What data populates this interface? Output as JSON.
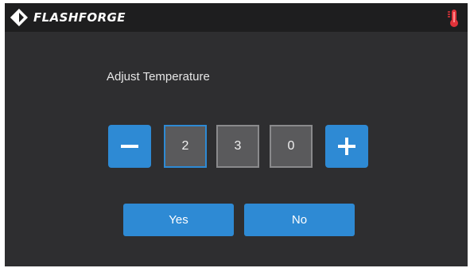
{
  "header": {
    "brand": "FLASHFORGE",
    "logo_icon": "flashforge-diamond-logo",
    "status_icon": "thermometer-icon"
  },
  "dialog": {
    "title": "Adjust Temperature",
    "decrement_icon": "minus-icon",
    "increment_icon": "plus-icon",
    "digits": [
      "2",
      "3",
      "0"
    ],
    "selected_digit_index": 0,
    "yes_label": "Yes",
    "no_label": "No"
  },
  "colors": {
    "accent": "#2e8ad4",
    "background": "#2e2e30",
    "topbar": "#1e1e1f",
    "digit_box": "#5a5a5c",
    "thermometer": "#e0333a"
  }
}
